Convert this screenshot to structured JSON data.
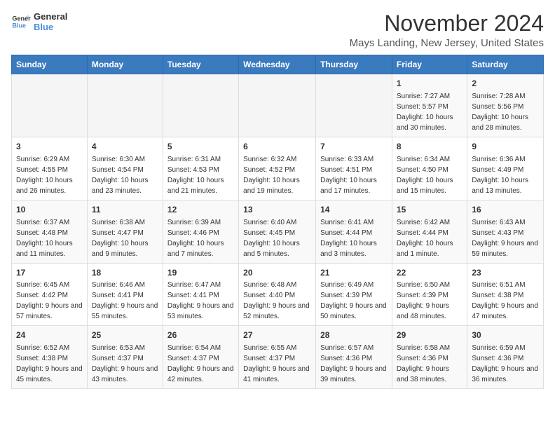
{
  "logo": {
    "line1": "General",
    "line2": "Blue"
  },
  "title": "November 2024",
  "subtitle": "Mays Landing, New Jersey, United States",
  "weekdays": [
    "Sunday",
    "Monday",
    "Tuesday",
    "Wednesday",
    "Thursday",
    "Friday",
    "Saturday"
  ],
  "weeks": [
    [
      {
        "day": "",
        "info": ""
      },
      {
        "day": "",
        "info": ""
      },
      {
        "day": "",
        "info": ""
      },
      {
        "day": "",
        "info": ""
      },
      {
        "day": "",
        "info": ""
      },
      {
        "day": "1",
        "info": "Sunrise: 7:27 AM\nSunset: 5:57 PM\nDaylight: 10 hours and 30 minutes."
      },
      {
        "day": "2",
        "info": "Sunrise: 7:28 AM\nSunset: 5:56 PM\nDaylight: 10 hours and 28 minutes."
      }
    ],
    [
      {
        "day": "3",
        "info": "Sunrise: 6:29 AM\nSunset: 4:55 PM\nDaylight: 10 hours and 26 minutes."
      },
      {
        "day": "4",
        "info": "Sunrise: 6:30 AM\nSunset: 4:54 PM\nDaylight: 10 hours and 23 minutes."
      },
      {
        "day": "5",
        "info": "Sunrise: 6:31 AM\nSunset: 4:53 PM\nDaylight: 10 hours and 21 minutes."
      },
      {
        "day": "6",
        "info": "Sunrise: 6:32 AM\nSunset: 4:52 PM\nDaylight: 10 hours and 19 minutes."
      },
      {
        "day": "7",
        "info": "Sunrise: 6:33 AM\nSunset: 4:51 PM\nDaylight: 10 hours and 17 minutes."
      },
      {
        "day": "8",
        "info": "Sunrise: 6:34 AM\nSunset: 4:50 PM\nDaylight: 10 hours and 15 minutes."
      },
      {
        "day": "9",
        "info": "Sunrise: 6:36 AM\nSunset: 4:49 PM\nDaylight: 10 hours and 13 minutes."
      }
    ],
    [
      {
        "day": "10",
        "info": "Sunrise: 6:37 AM\nSunset: 4:48 PM\nDaylight: 10 hours and 11 minutes."
      },
      {
        "day": "11",
        "info": "Sunrise: 6:38 AM\nSunset: 4:47 PM\nDaylight: 10 hours and 9 minutes."
      },
      {
        "day": "12",
        "info": "Sunrise: 6:39 AM\nSunset: 4:46 PM\nDaylight: 10 hours and 7 minutes."
      },
      {
        "day": "13",
        "info": "Sunrise: 6:40 AM\nSunset: 4:45 PM\nDaylight: 10 hours and 5 minutes."
      },
      {
        "day": "14",
        "info": "Sunrise: 6:41 AM\nSunset: 4:44 PM\nDaylight: 10 hours and 3 minutes."
      },
      {
        "day": "15",
        "info": "Sunrise: 6:42 AM\nSunset: 4:44 PM\nDaylight: 10 hours and 1 minute."
      },
      {
        "day": "16",
        "info": "Sunrise: 6:43 AM\nSunset: 4:43 PM\nDaylight: 9 hours and 59 minutes."
      }
    ],
    [
      {
        "day": "17",
        "info": "Sunrise: 6:45 AM\nSunset: 4:42 PM\nDaylight: 9 hours and 57 minutes."
      },
      {
        "day": "18",
        "info": "Sunrise: 6:46 AM\nSunset: 4:41 PM\nDaylight: 9 hours and 55 minutes."
      },
      {
        "day": "19",
        "info": "Sunrise: 6:47 AM\nSunset: 4:41 PM\nDaylight: 9 hours and 53 minutes."
      },
      {
        "day": "20",
        "info": "Sunrise: 6:48 AM\nSunset: 4:40 PM\nDaylight: 9 hours and 52 minutes."
      },
      {
        "day": "21",
        "info": "Sunrise: 6:49 AM\nSunset: 4:39 PM\nDaylight: 9 hours and 50 minutes."
      },
      {
        "day": "22",
        "info": "Sunrise: 6:50 AM\nSunset: 4:39 PM\nDaylight: 9 hours and 48 minutes."
      },
      {
        "day": "23",
        "info": "Sunrise: 6:51 AM\nSunset: 4:38 PM\nDaylight: 9 hours and 47 minutes."
      }
    ],
    [
      {
        "day": "24",
        "info": "Sunrise: 6:52 AM\nSunset: 4:38 PM\nDaylight: 9 hours and 45 minutes."
      },
      {
        "day": "25",
        "info": "Sunrise: 6:53 AM\nSunset: 4:37 PM\nDaylight: 9 hours and 43 minutes."
      },
      {
        "day": "26",
        "info": "Sunrise: 6:54 AM\nSunset: 4:37 PM\nDaylight: 9 hours and 42 minutes."
      },
      {
        "day": "27",
        "info": "Sunrise: 6:55 AM\nSunset: 4:37 PM\nDaylight: 9 hours and 41 minutes."
      },
      {
        "day": "28",
        "info": "Sunrise: 6:57 AM\nSunset: 4:36 PM\nDaylight: 9 hours and 39 minutes."
      },
      {
        "day": "29",
        "info": "Sunrise: 6:58 AM\nSunset: 4:36 PM\nDaylight: 9 hours and 38 minutes."
      },
      {
        "day": "30",
        "info": "Sunrise: 6:59 AM\nSunset: 4:36 PM\nDaylight: 9 hours and 36 minutes."
      }
    ]
  ]
}
